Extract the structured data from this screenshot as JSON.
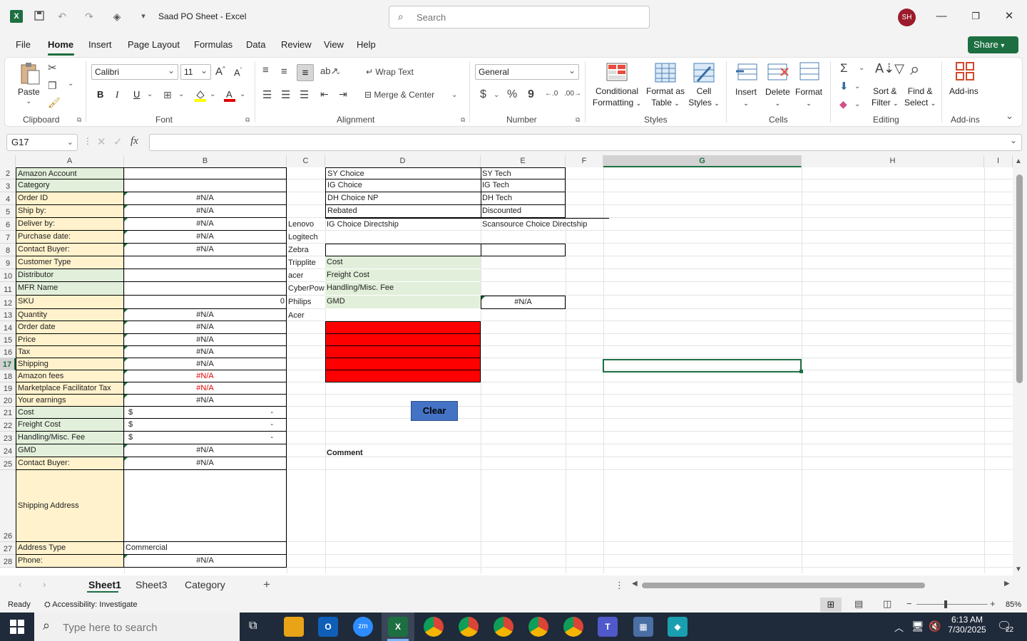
{
  "window": {
    "title": "Saad PO Sheet  -  Excel",
    "search_placeholder": "Search",
    "avatar_initials": "SH",
    "excel_logo": "X"
  },
  "menu": {
    "file": "File",
    "home": "Home",
    "insert": "Insert",
    "page_layout": "Page Layout",
    "formulas": "Formulas",
    "data": "Data",
    "review": "Review",
    "view": "View",
    "help": "Help",
    "share": "Share"
  },
  "ribbon": {
    "clipboard": {
      "label": "Clipboard",
      "paste": "Paste"
    },
    "font": {
      "label": "Font",
      "name": "Calibri",
      "size": "11",
      "bold": "B",
      "italic": "I",
      "underline": "U"
    },
    "alignment": {
      "label": "Alignment",
      "wrap_text": "Wrap Text",
      "merge_center": "Merge & Center"
    },
    "number": {
      "label": "Number",
      "format": "General",
      "currency": "$",
      "percent": "%",
      "comma": "9"
    },
    "styles": {
      "label": "Styles",
      "conditional": "Conditional",
      "formatting": "Formatting",
      "format_as": "Format as",
      "table": "Table",
      "cell": "Cell",
      "cell_styles": "Styles"
    },
    "cells": {
      "label": "Cells",
      "insert": "Insert",
      "delete": "Delete",
      "format": "Format"
    },
    "editing": {
      "label": "Editing",
      "sort": "Sort &",
      "filter": "Filter",
      "find": "Find &",
      "select": "Select"
    },
    "addins": {
      "label": "Add-ins",
      "addins": "Add-ins"
    }
  },
  "formula_bar": {
    "name_box": "G17",
    "fx": "fx",
    "value": ""
  },
  "columns": [
    "A",
    "B",
    "C",
    "D",
    "E",
    "F",
    "G",
    "H",
    "I"
  ],
  "rows": [
    {
      "n": "2",
      "a": "Amazon Account",
      "ac": "green",
      "b": ""
    },
    {
      "n": "3",
      "a": "Category",
      "ac": "green",
      "b": ""
    },
    {
      "n": "4",
      "a": "Order ID",
      "ac": "yellow",
      "b": "#N/A",
      "tri": true
    },
    {
      "n": "5",
      "a": "Ship by:",
      "ac": "yellow",
      "b": "#N/A",
      "tri": true
    },
    {
      "n": "6",
      "a": "Deliver by:",
      "ac": "yellow",
      "b": "#N/A",
      "tri": true
    },
    {
      "n": "7",
      "a": "Purchase date:",
      "ac": "yellow",
      "b": "#N/A",
      "tri": true
    },
    {
      "n": "8",
      "a": "Contact Buyer:",
      "ac": "yellow",
      "b": "#N/A",
      "tri": true
    },
    {
      "n": "9",
      "a": "Customer Type",
      "ac": "yellow",
      "b": ""
    },
    {
      "n": "10",
      "a": "Distributor",
      "ac": "green",
      "b": ""
    },
    {
      "n": "11",
      "a": "MFR Name",
      "ac": "green",
      "b": ""
    },
    {
      "n": "12",
      "a": "SKU",
      "ac": "yellow",
      "b": "0",
      "right": true
    },
    {
      "n": "13",
      "a": "Quantity",
      "ac": "yellow",
      "b": "#N/A",
      "tri": true
    },
    {
      "n": "14",
      "a": "Order date",
      "ac": "yellow",
      "b": "#N/A",
      "tri": true
    },
    {
      "n": "15",
      "a": "Price",
      "ac": "yellow",
      "b": "#N/A",
      "tri": true
    },
    {
      "n": "16",
      "a": "Tax",
      "ac": "yellow",
      "b": "#N/A",
      "tri": true
    },
    {
      "n": "17",
      "a": "Shipping",
      "ac": "yellow",
      "b": "#N/A",
      "tri": true
    },
    {
      "n": "18",
      "a": "Amazon fees",
      "ac": "yellow",
      "b": "#N/A",
      "tri": true,
      "red": true
    },
    {
      "n": "19",
      "a": "Marketplace Facilitator Tax",
      "ac": "yellow",
      "b": "#N/A",
      "tri": true,
      "red": true
    },
    {
      "n": "20",
      "a": "Your earnings",
      "ac": "yellow",
      "b": "#N/A",
      "tri": true
    },
    {
      "n": "21",
      "a": "Cost",
      "ac": "green",
      "b": "$",
      "b2": "-"
    },
    {
      "n": "22",
      "a": "Freight Cost",
      "ac": "green",
      "b": "$",
      "b2": "-"
    },
    {
      "n": "23",
      "a": "Handling/Misc. Fee",
      "ac": "green",
      "b": "$",
      "b2": "-"
    },
    {
      "n": "24",
      "a": "GMD",
      "ac": "green",
      "b": "#N/A",
      "tri": true
    },
    {
      "n": "25",
      "a": "Contact Buyer:",
      "ac": "yellow",
      "b": "#N/A",
      "tri": true
    },
    {
      "n": "26",
      "a": "Shipping Address",
      "ac": "yellow",
      "b": "",
      "tall": true
    },
    {
      "n": "27",
      "a": "Address Type",
      "ac": "yellow",
      "b": "Commercial",
      "left": true
    },
    {
      "n": "28",
      "a": "Phone:",
      "ac": "yellow",
      "b": "#N/A",
      "tri": true
    }
  ],
  "col_c": [
    "Lenovo",
    "Logitech",
    "Zebra",
    "Tripplite",
    "acer",
    "CyberPow",
    "Philips",
    "Acer"
  ],
  "col_d_top": [
    "SY Choice",
    "IG Choice",
    "DH Choice NP",
    " Rebated",
    "IG Choice Directship"
  ],
  "col_e_top": [
    "SY Tech",
    "IG Tech",
    "DH Tech",
    " Discounted",
    "Scansource Choice Directship"
  ],
  "cost_labels": [
    "Cost",
    "Freight Cost",
    "Handling/Misc. Fee",
    "GMD"
  ],
  "gmd_value": "#N/A",
  "clear_button": "Clear",
  "comment_label": "Comment",
  "sheets": [
    "Sheet1",
    "Sheet3",
    "Category"
  ],
  "status": {
    "ready": "Ready",
    "accessibility": "Accessibility: Investigate",
    "zoom": "85%"
  },
  "taskbar": {
    "search_placeholder": "Type here to search",
    "time": "6:13 AM",
    "date": "7/30/2025",
    "notifications": "22"
  }
}
